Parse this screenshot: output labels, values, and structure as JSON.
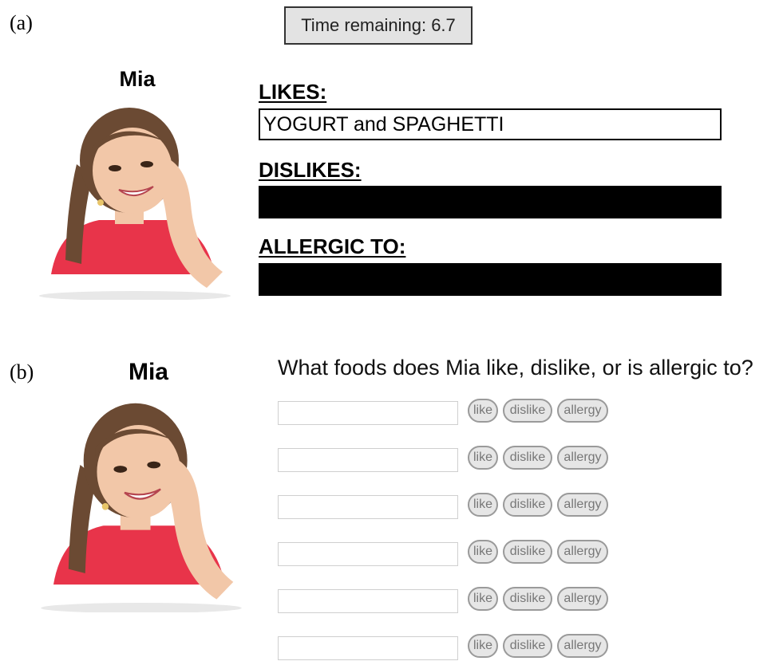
{
  "panel_a": {
    "label": "(a)",
    "timer_text": "Time remaining: 6.7",
    "child_name": "Mia",
    "likes_heading": "LIKES:",
    "likes_value": "YOGURT and SPAGHETTI",
    "dislikes_heading": "DISLIKES:",
    "allergic_heading": "ALLERGIC TO:"
  },
  "panel_b": {
    "label": "(b)",
    "child_name": "Mia",
    "question": "What foods does Mia like, dislike, or is allergic to?",
    "rows": [
      {
        "like": "like",
        "dislike": "dislike",
        "allergy": "allergy"
      },
      {
        "like": "like",
        "dislike": "dislike",
        "allergy": "allergy"
      },
      {
        "like": "like",
        "dislike": "dislike",
        "allergy": "allergy"
      },
      {
        "like": "like",
        "dislike": "dislike",
        "allergy": "allergy"
      },
      {
        "like": "like",
        "dislike": "dislike",
        "allergy": "allergy"
      },
      {
        "like": "like",
        "dislike": "dislike",
        "allergy": "allergy"
      }
    ]
  },
  "colors": {
    "timer_bg": "#e3e3e3",
    "redaction": "#000000",
    "pill_bg": "#e6e6e6",
    "shirt": "#e8344a",
    "hair": "#6b4a33",
    "skin": "#f2c7a8"
  }
}
